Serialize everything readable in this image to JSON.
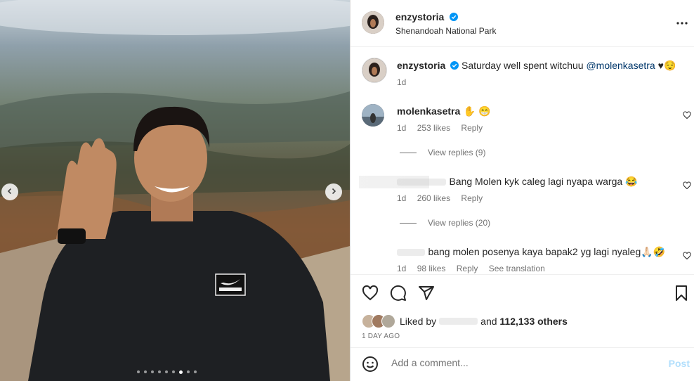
{
  "post": {
    "author": "enzystoria",
    "location": "Shenandoah National Park",
    "caption_text": "Saturday well spent witchuu ",
    "caption_mention": "@molenkasetra",
    "caption_emoji": "♥😌",
    "caption_time": "1d"
  },
  "comments": [
    {
      "username": "molenkasetra",
      "text": "✋ 😁",
      "time": "1d",
      "likes": "253 likes",
      "reply": "Reply",
      "view_replies": "View replies (9)"
    },
    {
      "username": "",
      "text": "Bang Molen kyk caleg lagi nyapa warga 😂",
      "time": "1d",
      "likes": "260 likes",
      "reply": "Reply",
      "view_replies": "View replies (20)"
    },
    {
      "username": "",
      "text": "bang molen posenya kaya bapak2 yg lagi nyaleg🙏🏻🤣",
      "time": "1d",
      "likes": "98 likes",
      "reply": "Reply",
      "see_translation": "See translation"
    }
  ],
  "likes": {
    "liked_by": "Liked by",
    "and": "and",
    "count": "112,133 others"
  },
  "date": "1 DAY AGO",
  "comment_box": {
    "placeholder": "Add a comment...",
    "post_label": "Post"
  },
  "carousel": {
    "total": 9,
    "active_index": 6
  },
  "colors": {
    "verified": "#0095f6",
    "mention": "#00376b",
    "post_disabled": "#b2dffc"
  }
}
